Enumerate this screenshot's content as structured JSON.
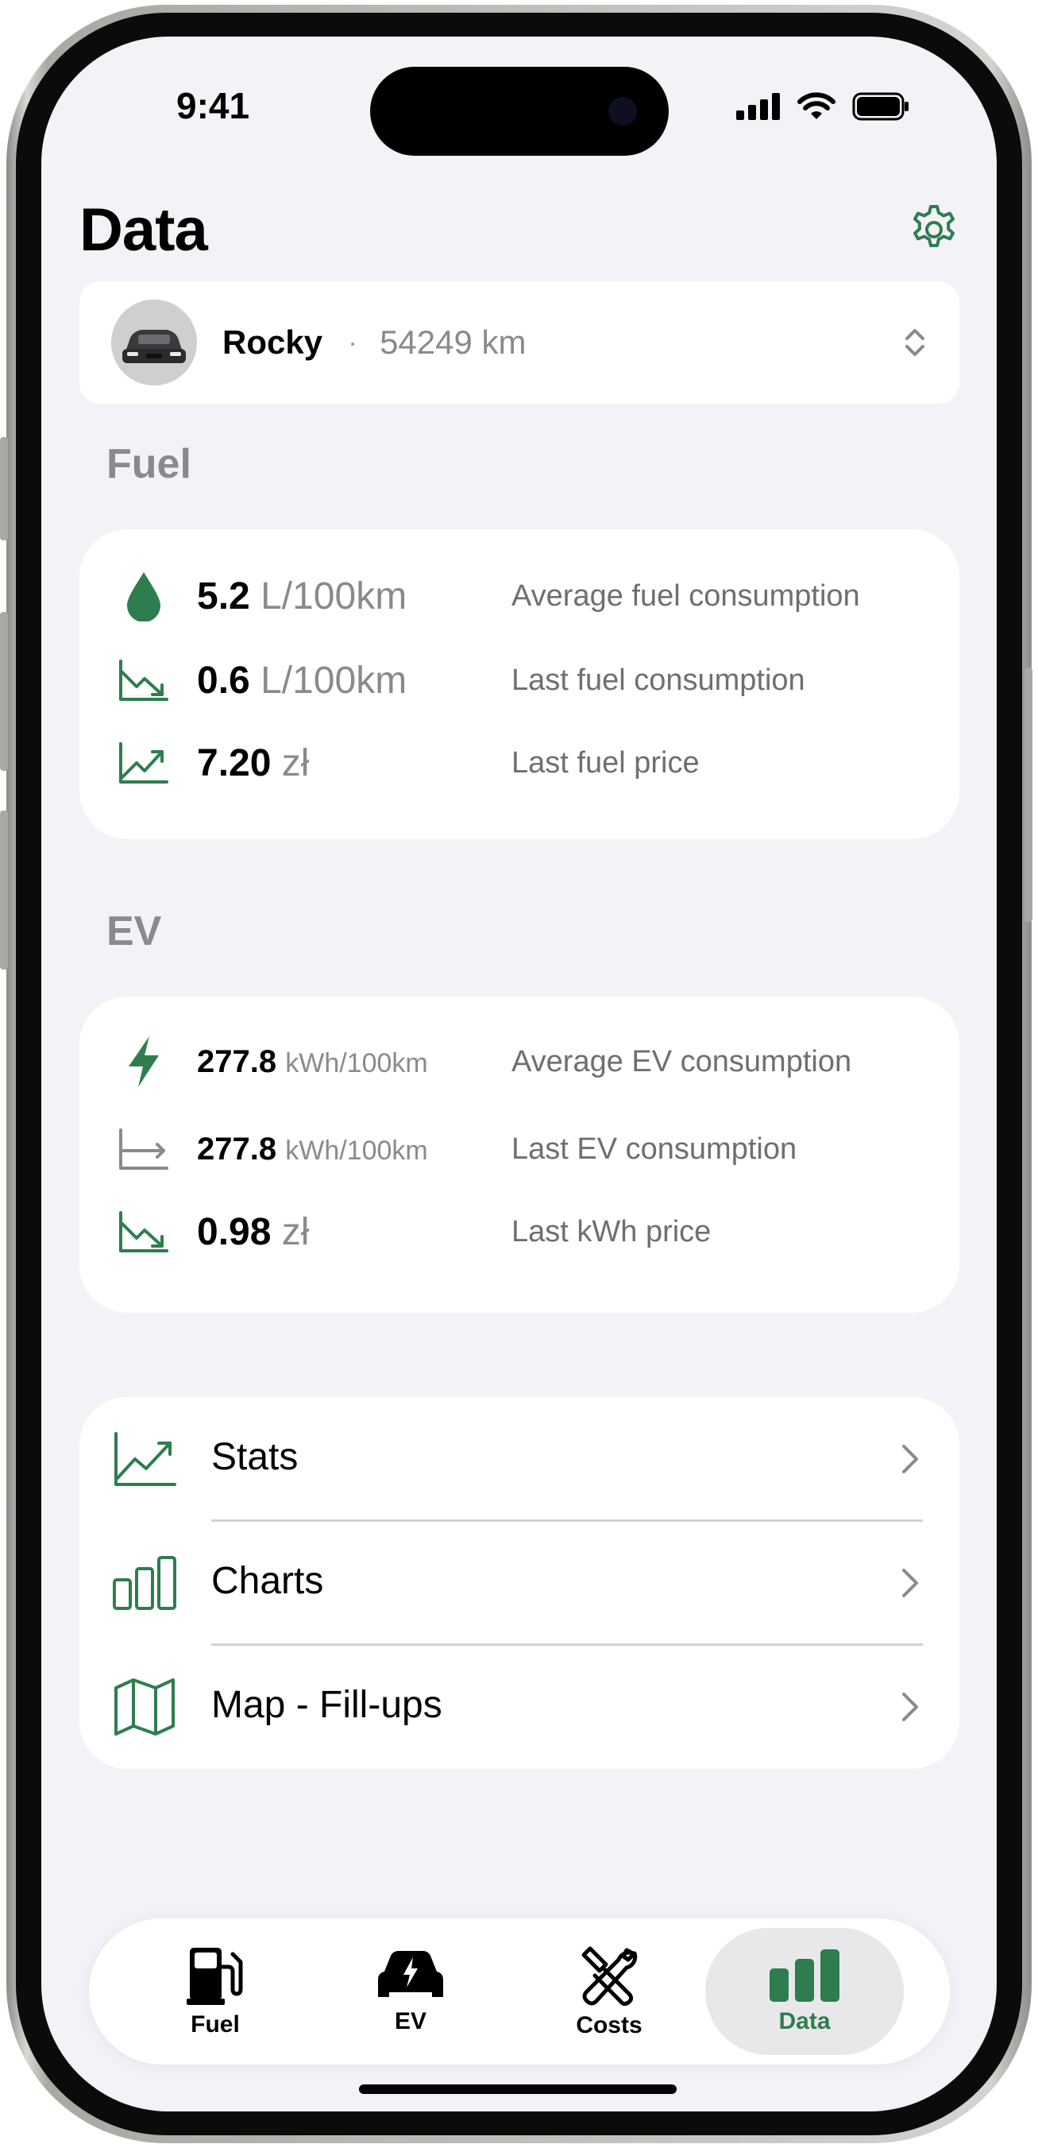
{
  "status_bar": {
    "time": "9:41"
  },
  "header": {
    "title": "Data"
  },
  "vehicle": {
    "name": "Rocky",
    "separator": "·",
    "odometer": "54249 km"
  },
  "fuel": {
    "section_title": "Fuel",
    "rows": [
      {
        "value": "5.2",
        "unit": "L/100km",
        "label": "Average fuel consumption",
        "icon": "drop-icon"
      },
      {
        "value": "0.6",
        "unit": "L/100km",
        "label": "Last fuel consumption",
        "icon": "trend-down-icon"
      },
      {
        "value": "7.20",
        "unit": "zł",
        "label": "Last fuel price",
        "icon": "trend-up-icon"
      }
    ]
  },
  "ev": {
    "section_title": "EV",
    "rows": [
      {
        "value": "277.8",
        "unit": "kWh/100km",
        "label": "Average EV consumption",
        "icon": "bolt-icon"
      },
      {
        "value": "277.8",
        "unit": "kWh/100km",
        "label": "Last EV consumption",
        "icon": "trend-flat-icon"
      },
      {
        "value": "0.98",
        "unit": "zł",
        "label": "Last kWh price",
        "icon": "trend-down-icon"
      }
    ]
  },
  "links": [
    {
      "label": "Stats",
      "icon": "trend-up-icon"
    },
    {
      "label": "Charts",
      "icon": "bar-chart-icon"
    },
    {
      "label": "Map - Fill-ups",
      "icon": "map-icon"
    }
  ],
  "tabs": [
    {
      "label": "Fuel",
      "icon": "fuel-pump-icon"
    },
    {
      "label": "EV",
      "icon": "ev-car-icon"
    },
    {
      "label": "Costs",
      "icon": "tools-icon"
    },
    {
      "label": "Data",
      "icon": "bar-chart-icon",
      "active": true
    }
  ],
  "colors": {
    "accent": "#2e7d4f",
    "background": "#f2f2f7",
    "secondary_text": "#8a8a8e"
  }
}
